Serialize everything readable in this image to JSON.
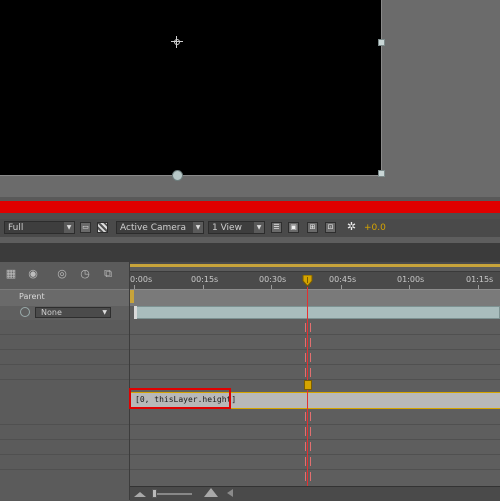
{
  "viewer": {
    "resolution": "Full",
    "camera": "Active Camera",
    "views": "1 View",
    "exposure": "+0.0"
  },
  "timeline": {
    "ruler_labels": [
      "0:00s",
      "00:15s",
      "00:30s",
      "00:45s",
      "01:00s",
      "01:15s"
    ],
    "parent_header": "Parent",
    "parent_value": "None",
    "expression_text": "[0, thisLayer.height]"
  },
  "colors": {
    "highlight": "#e00000",
    "work_area": "#c7a33a",
    "layer_bar": "#a9bdbd",
    "cti": "#e53030"
  },
  "icons": [
    "anchor-point-icon",
    "composition-icon",
    "transparency-grid-icon",
    "toggle-icon",
    "motion-blur-icon",
    "graph-editor-icon",
    "stopwatch-icon",
    "eye-icon"
  ]
}
